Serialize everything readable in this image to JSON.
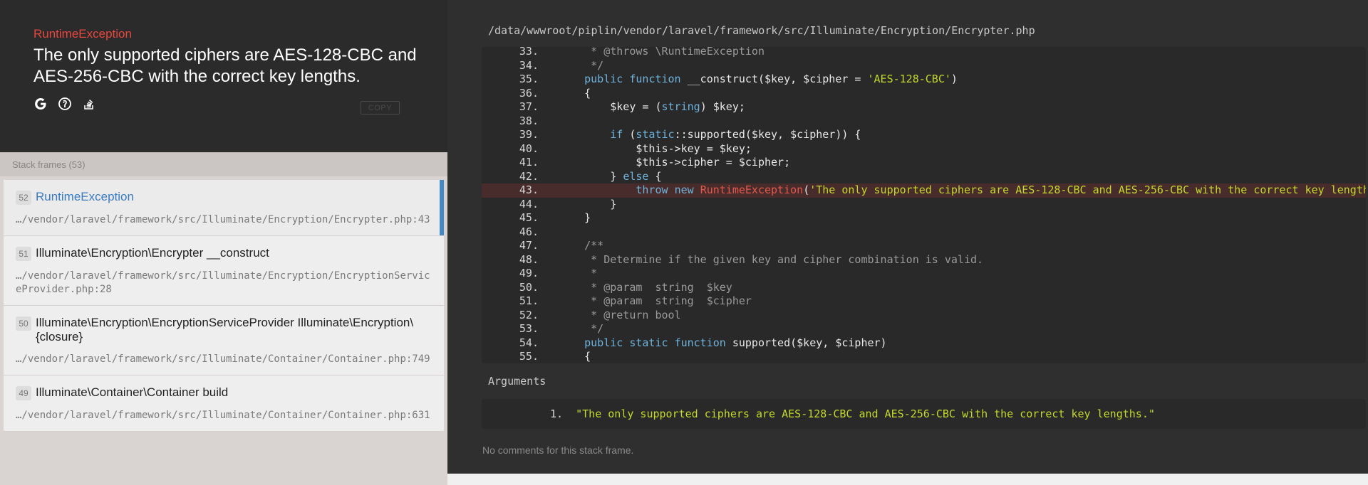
{
  "exception": {
    "class": "RuntimeException",
    "message": "The only supported ciphers are AES-128-CBC and AES-256-CBC with the correct key lengths.",
    "search_icons": [
      "google-icon",
      "duckduckgo-icon",
      "stackoverflow-icon"
    ],
    "copy_label": "COPY"
  },
  "frames": {
    "title": "Stack frames (53)",
    "items": [
      {
        "index": "52",
        "name": "RuntimeException",
        "file": "…/vendor/laravel/framework/src/Illuminate/Encryption/Encrypter.php:43"
      },
      {
        "index": "51",
        "name": "Illuminate\\Encryption\\Encrypter __construct",
        "file": "…/vendor/laravel/framework/src/Illuminate/Encryption/EncryptionServiceProvider.php:28"
      },
      {
        "index": "50",
        "name": "Illuminate\\Encryption\\EncryptionServiceProvider Illuminate\\Encryption\\{closure}",
        "file": "…/vendor/laravel/framework/src/Illuminate/Container/Container.php:749"
      },
      {
        "index": "49",
        "name": "Illuminate\\Container\\Container build",
        "file": "…/vendor/laravel/framework/src/Illuminate/Container/Container.php:631"
      }
    ]
  },
  "code": {
    "file_path": "/data/wwwroot/piplin/vendor/laravel/framework/src/Illuminate/Encryption/Encrypter.php",
    "highlight_line": "43.",
    "lines": [
      {
        "n": "33.",
        "text": "     * @throws \\RuntimeException"
      },
      {
        "n": "34.",
        "text": "     */"
      },
      {
        "n": "35.",
        "text": "    public function __construct($key, $cipher = 'AES-128-CBC')"
      },
      {
        "n": "36.",
        "text": "    {"
      },
      {
        "n": "37.",
        "text": "        $key = (string) $key;"
      },
      {
        "n": "38.",
        "text": ""
      },
      {
        "n": "39.",
        "text": "        if (static::supported($key, $cipher)) {"
      },
      {
        "n": "40.",
        "text": "            $this->key = $key;"
      },
      {
        "n": "41.",
        "text": "            $this->cipher = $cipher;"
      },
      {
        "n": "42.",
        "text": "        } else {"
      },
      {
        "n": "43.",
        "text": "            throw new RuntimeException('The only supported ciphers are AES-128-CBC and AES-256-CBC with the correct key lengths.');"
      },
      {
        "n": "44.",
        "text": "        }"
      },
      {
        "n": "45.",
        "text": "    }"
      },
      {
        "n": "46.",
        "text": ""
      },
      {
        "n": "47.",
        "text": "    /**"
      },
      {
        "n": "48.",
        "text": "     * Determine if the given key and cipher combination is valid."
      },
      {
        "n": "49.",
        "text": "     *"
      },
      {
        "n": "50.",
        "text": "     * @param  string  $key"
      },
      {
        "n": "51.",
        "text": "     * @param  string  $cipher"
      },
      {
        "n": "52.",
        "text": "     * @return bool"
      },
      {
        "n": "53.",
        "text": "     */"
      },
      {
        "n": "54.",
        "text": "    public static function supported($key, $cipher)"
      },
      {
        "n": "55.",
        "text": "    {"
      }
    ]
  },
  "arguments": {
    "label": "Arguments",
    "items": [
      {
        "num": "1.",
        "value": "\"The only supported ciphers are AES-128-CBC and AES-256-CBC with the correct key lengths.\""
      }
    ]
  },
  "comments": {
    "empty_text": "No comments for this stack frame."
  },
  "colors": {
    "exception_class": "#e8473e",
    "active_frame_accent": "#4289c7",
    "string": "#c4d92c",
    "keyword": "#6fb3dc"
  }
}
